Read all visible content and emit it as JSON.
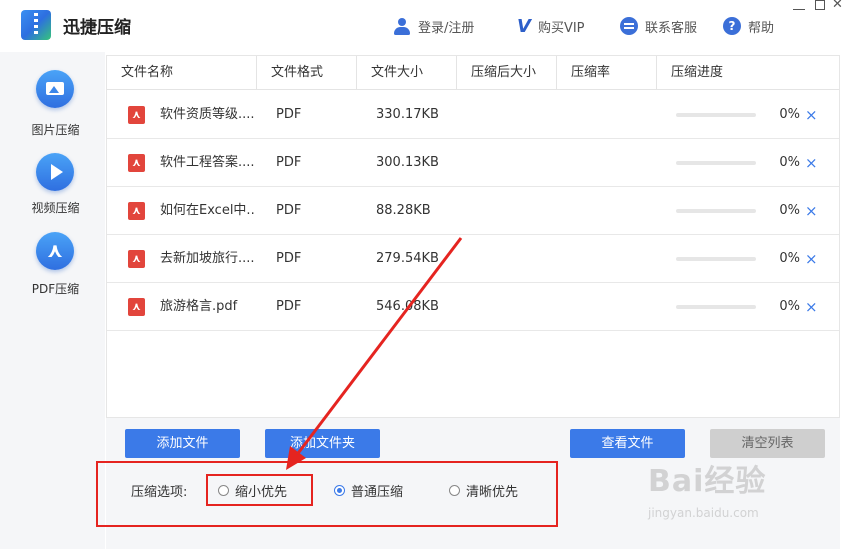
{
  "app": {
    "title": "迅捷压缩"
  },
  "header": {
    "login": "登录/注册",
    "vip": "购买VIP",
    "service": "联系客服",
    "help": "帮助"
  },
  "sidebar": {
    "items": [
      {
        "label": "图片压缩",
        "icon": "image-icon"
      },
      {
        "label": "视频压缩",
        "icon": "play-icon"
      },
      {
        "label": "PDF压缩",
        "icon": "pdf-icon"
      }
    ]
  },
  "table": {
    "columns": [
      "文件名称",
      "文件格式",
      "文件大小",
      "压缩后大小",
      "压缩率",
      "压缩进度"
    ],
    "rows": [
      {
        "name": "软件资质等级....",
        "format": "PDF",
        "size": "330.17KB",
        "progress": "0%"
      },
      {
        "name": "软件工程答案....",
        "format": "PDF",
        "size": "300.13KB",
        "progress": "0%"
      },
      {
        "name": "如何在Excel中..",
        "format": "PDF",
        "size": "88.28KB",
        "progress": "0%"
      },
      {
        "name": "去新加坡旅行....",
        "format": "PDF",
        "size": "279.54KB",
        "progress": "0%"
      },
      {
        "name": "旅游格言.pdf",
        "format": "PDF",
        "size": "546.08KB",
        "progress": "0%"
      }
    ],
    "delete_symbol": "×"
  },
  "buttons": {
    "add_file": "添加文件",
    "add_folder": "添加文件夹",
    "view_files": "查看文件",
    "clear_list": "清空列表"
  },
  "options": {
    "label": "压缩选项:",
    "items": [
      "缩小优先",
      "普通压缩",
      "清晰优先"
    ],
    "selected": "普通压缩"
  },
  "watermark": {
    "line1": "Bai经验",
    "line2": "jingyan.baidu.com"
  },
  "colors": {
    "accent": "#3b7ae8",
    "annotation": "#e52420",
    "pdf_red": "#e2453c"
  }
}
